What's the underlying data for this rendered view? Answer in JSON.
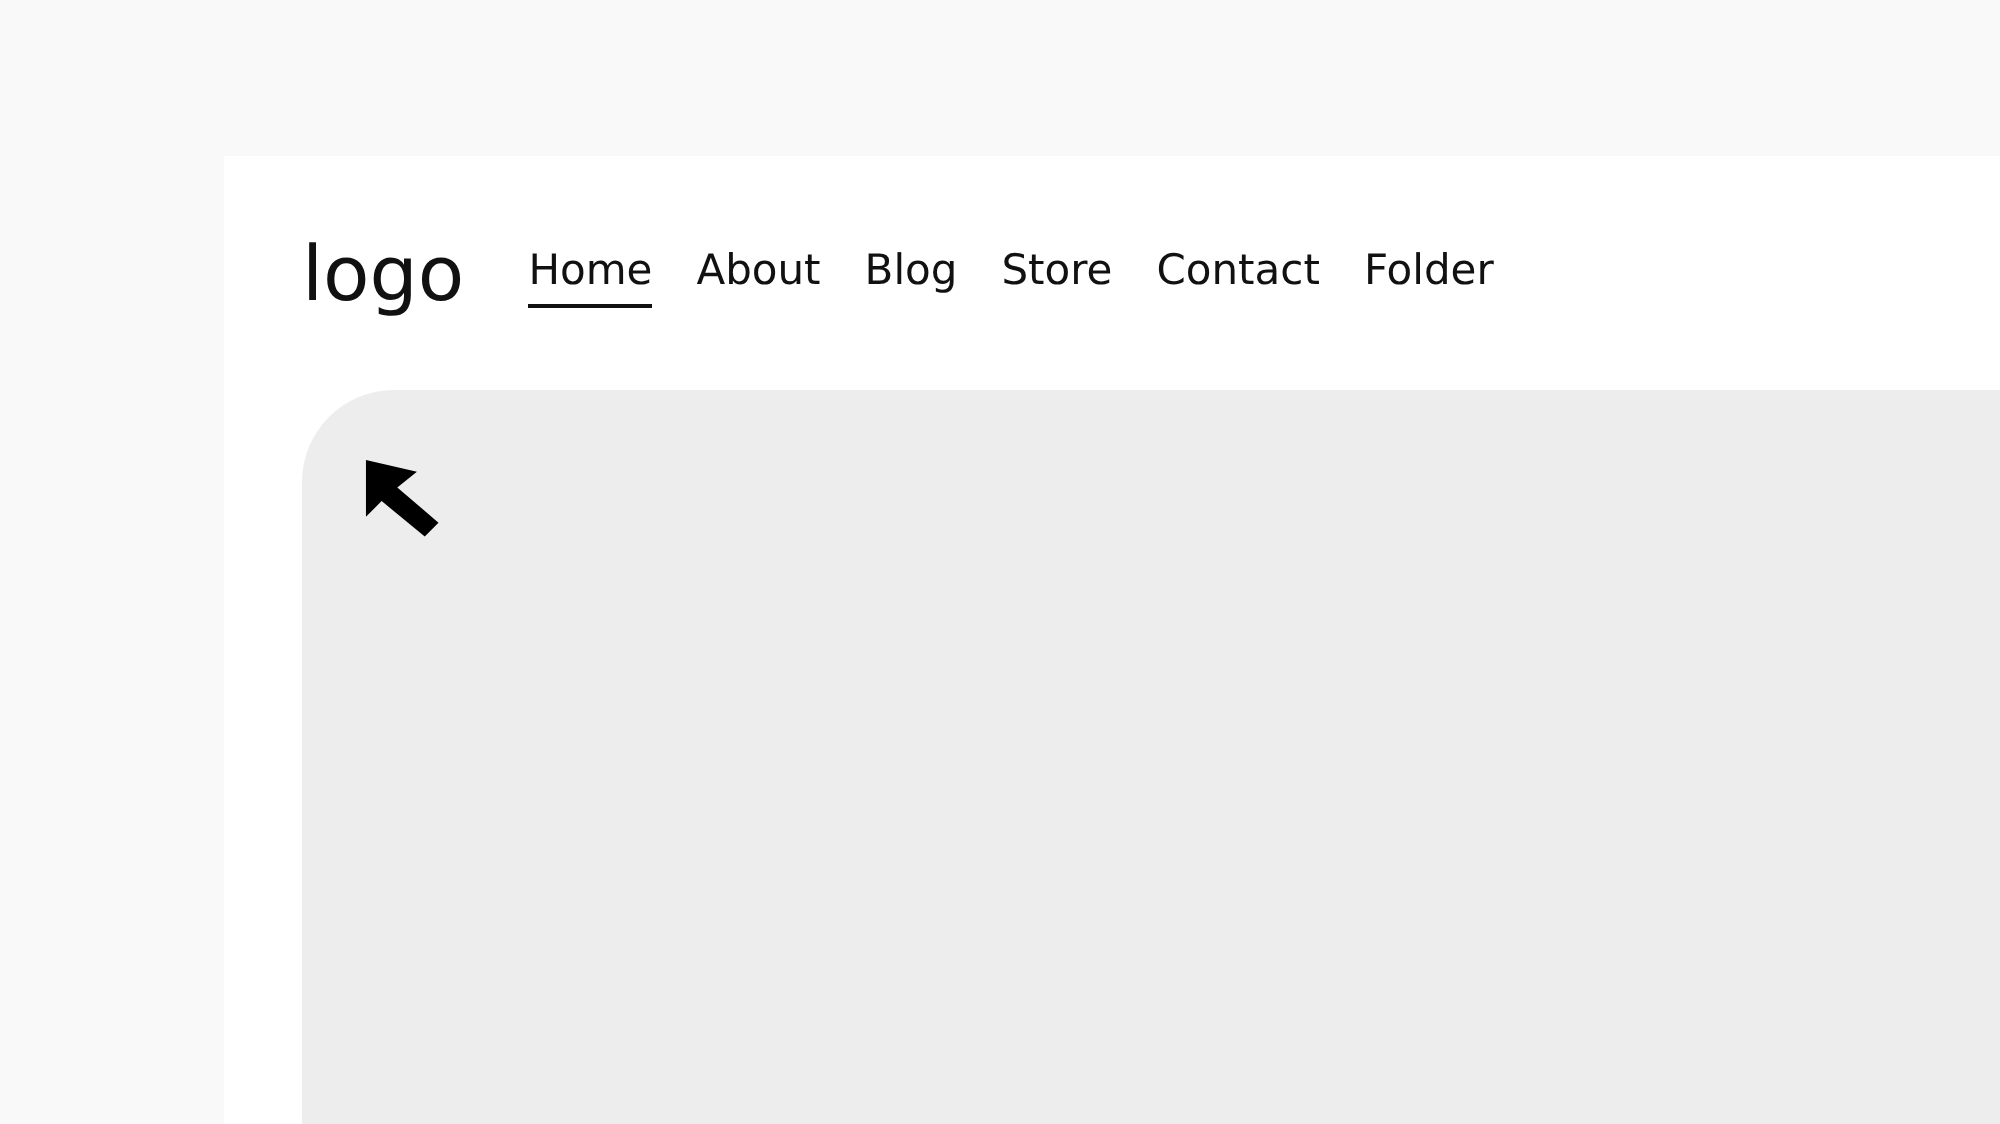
{
  "logo": "logo",
  "nav": [
    {
      "label": "Home",
      "selected": true
    },
    {
      "label": "About",
      "selected": false
    },
    {
      "label": "Blog",
      "selected": false
    },
    {
      "label": "Store",
      "selected": false
    },
    {
      "label": "Contact",
      "selected": false
    },
    {
      "label": "Folder",
      "selected": false
    }
  ]
}
